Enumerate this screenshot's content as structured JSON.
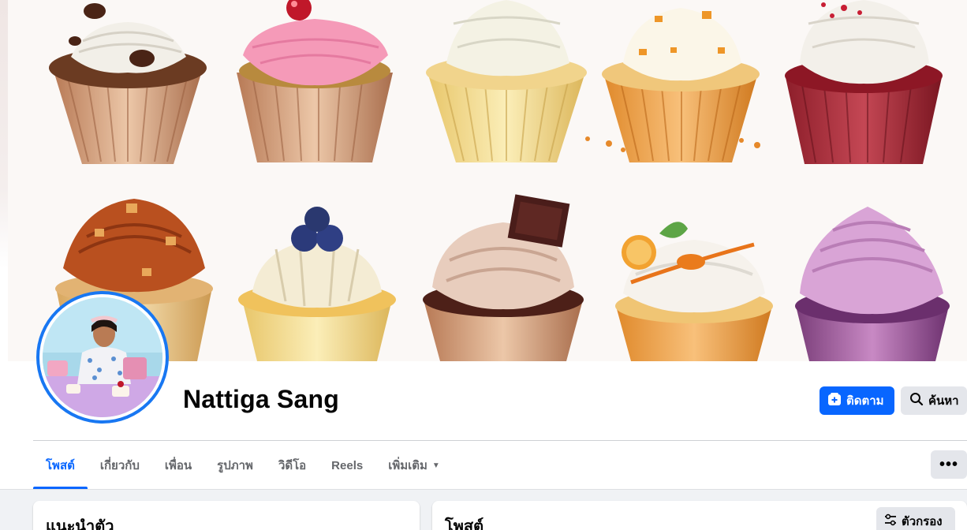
{
  "profile": {
    "name": "Nattiga Sang"
  },
  "actions": {
    "follow_label": "ติดตาม",
    "search_label": "ค้นหา",
    "follow_icon": "follow-plus-icon",
    "search_icon": "search-icon",
    "more_label": "•••"
  },
  "tabs": [
    {
      "label": "โพสต์",
      "active": true
    },
    {
      "label": "เกี่ยวกับ",
      "active": false
    },
    {
      "label": "เพื่อน",
      "active": false
    },
    {
      "label": "รูปภาพ",
      "active": false
    },
    {
      "label": "วิดีโอ",
      "active": false
    },
    {
      "label": "Reels",
      "active": false
    },
    {
      "label": "เพิ่มเติม",
      "active": false,
      "has_dropdown": true
    }
  ],
  "sections": {
    "intro_title": "แนะนำตัว",
    "posts_title": "โพสต์",
    "filter_label": "ตัวกรอง",
    "filter_icon": "filter-sliders-icon"
  },
  "colors": {
    "accent": "#0866ff",
    "button_gray": "#e4e6eb",
    "page_bg": "#f0f2f5"
  }
}
